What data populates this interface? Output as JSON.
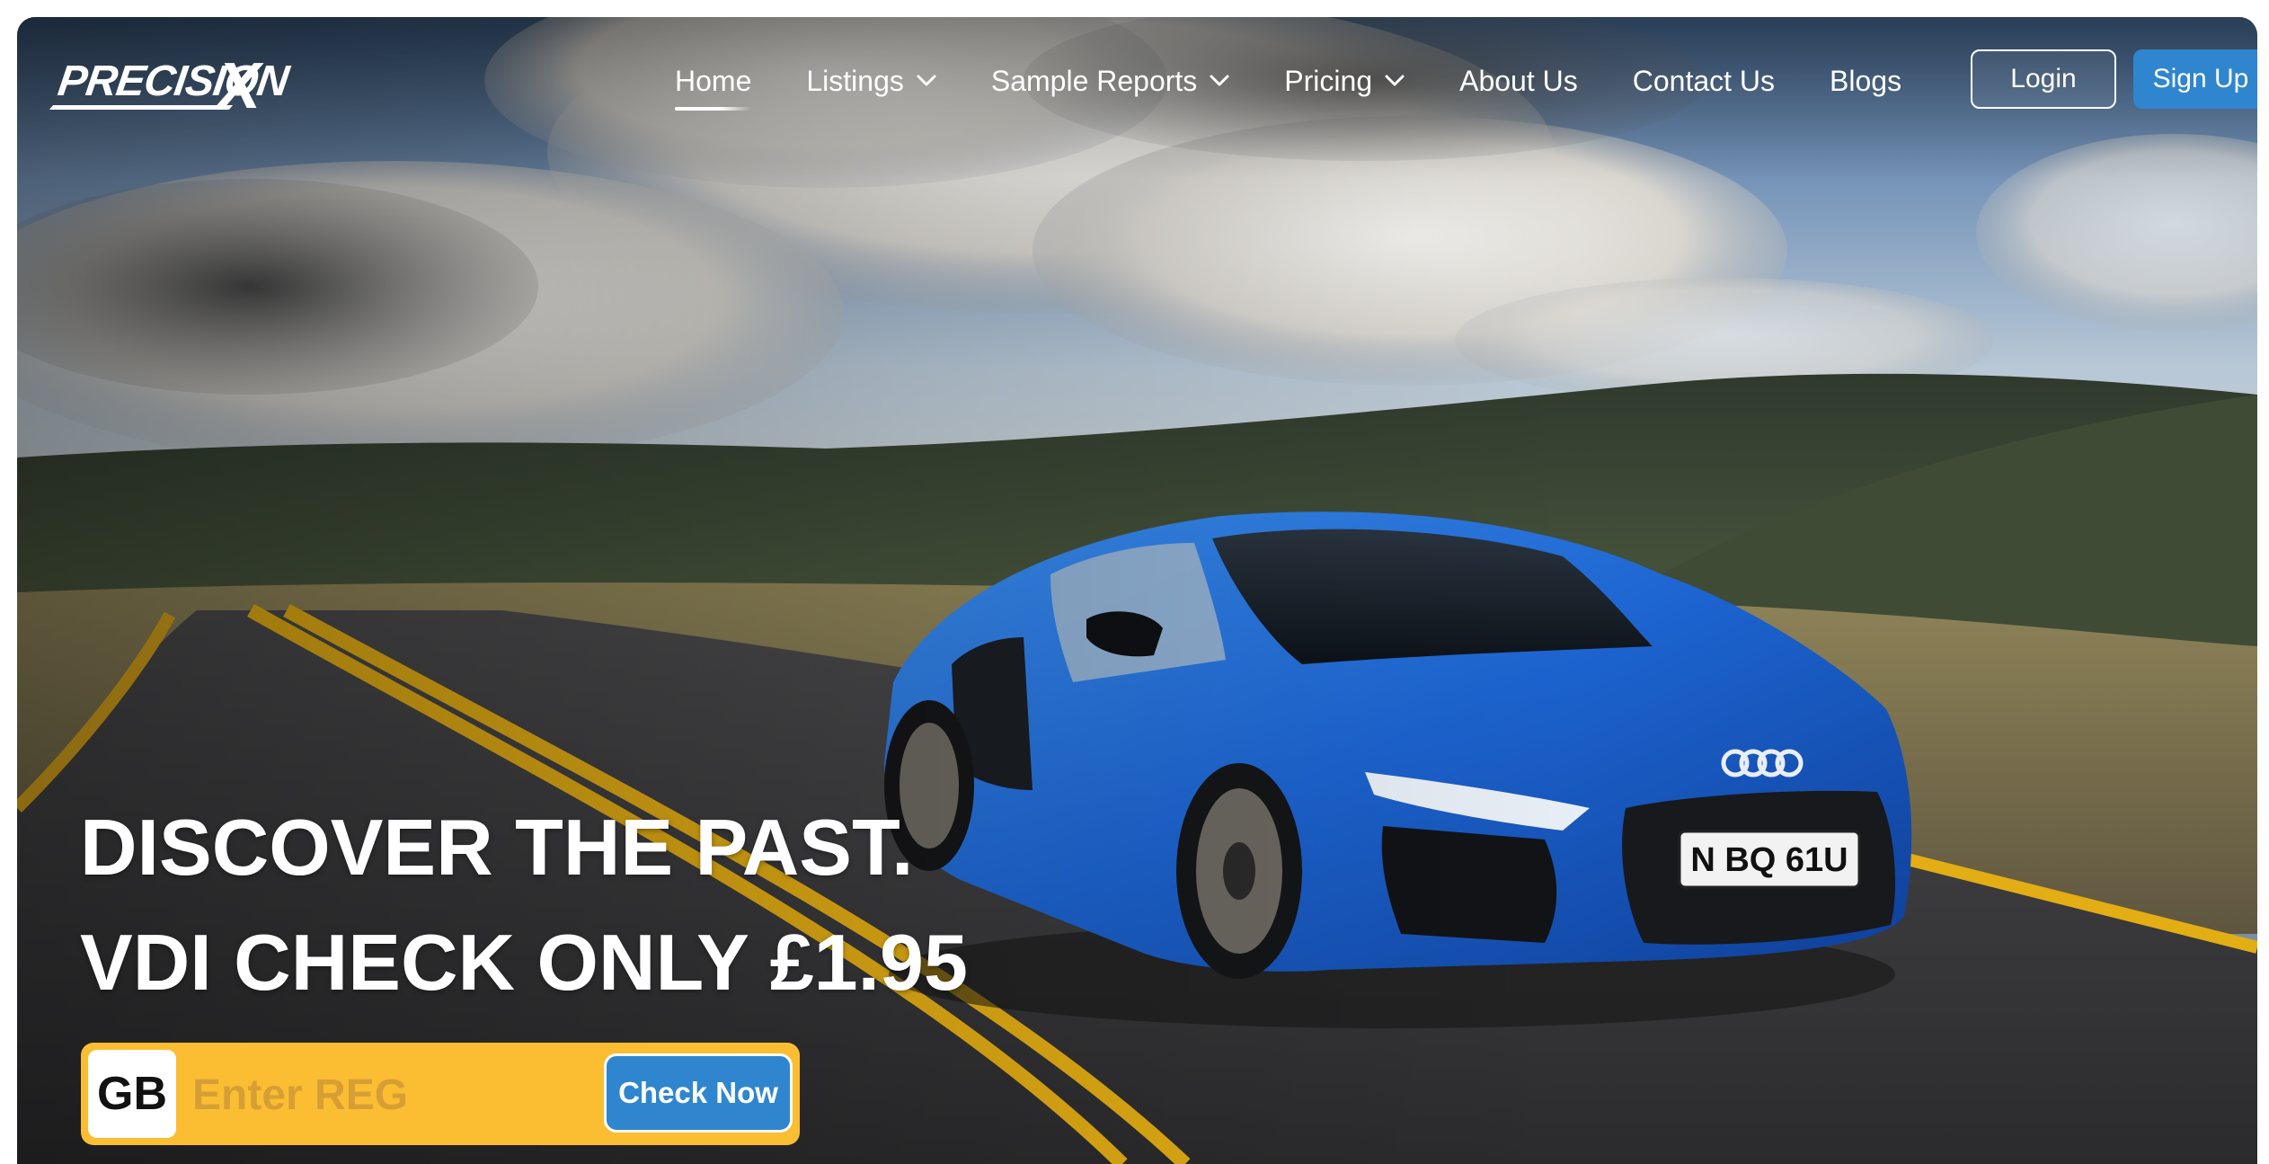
{
  "brand": {
    "logo_text": "PRECISION",
    "logo_mark": "X"
  },
  "nav": {
    "items": [
      {
        "label": "Home",
        "active": true,
        "dropdown": false
      },
      {
        "label": "Listings",
        "active": false,
        "dropdown": true
      },
      {
        "label": "Sample Reports",
        "active": false,
        "dropdown": true
      },
      {
        "label": "Pricing",
        "active": false,
        "dropdown": true
      },
      {
        "label": "About Us",
        "active": false,
        "dropdown": false
      },
      {
        "label": "Contact Us",
        "active": false,
        "dropdown": false
      },
      {
        "label": "Blogs",
        "active": false,
        "dropdown": false
      }
    ],
    "login_label": "Login",
    "signup_label": "Sign Up"
  },
  "hero": {
    "line1": "DISCOVER THE PAST.",
    "line2": "VDI CHECK ONLY £1.95",
    "plate_text": "N BQ 61U"
  },
  "reg_search": {
    "country": "GB",
    "placeholder": "Enter REG",
    "value": "",
    "button_label": "Check Now"
  },
  "colors": {
    "accent_blue": "#2f86cf",
    "plate_yellow": "#fbbd32",
    "car_blue": "#1f63c7"
  }
}
